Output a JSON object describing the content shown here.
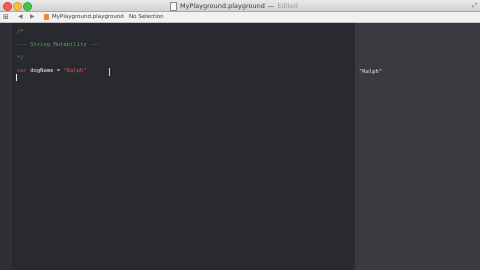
{
  "window": {
    "title": "MyPlayground.playground",
    "status": "Edited"
  },
  "jumpbar": {
    "playground_name": "MyPlayground.playground",
    "separator": "›",
    "selection": "No Selection"
  },
  "editor": {
    "lines": [
      {
        "text": "/*"
      },
      {
        "text": "--- String Mutability ---"
      },
      {
        "text": "*/"
      }
    ],
    "declaration": {
      "keyword": "var",
      "name": "dogName",
      "operator": " = ",
      "value": "\"Ralph\""
    }
  },
  "results": {
    "value": "\"Ralph\""
  },
  "icons": {
    "grid": "grid-icon",
    "back": "chevron-left-icon",
    "forward": "chevron-right-icon",
    "playground": "playground-file-icon",
    "fullscreen": "fullscreen-icon"
  }
}
